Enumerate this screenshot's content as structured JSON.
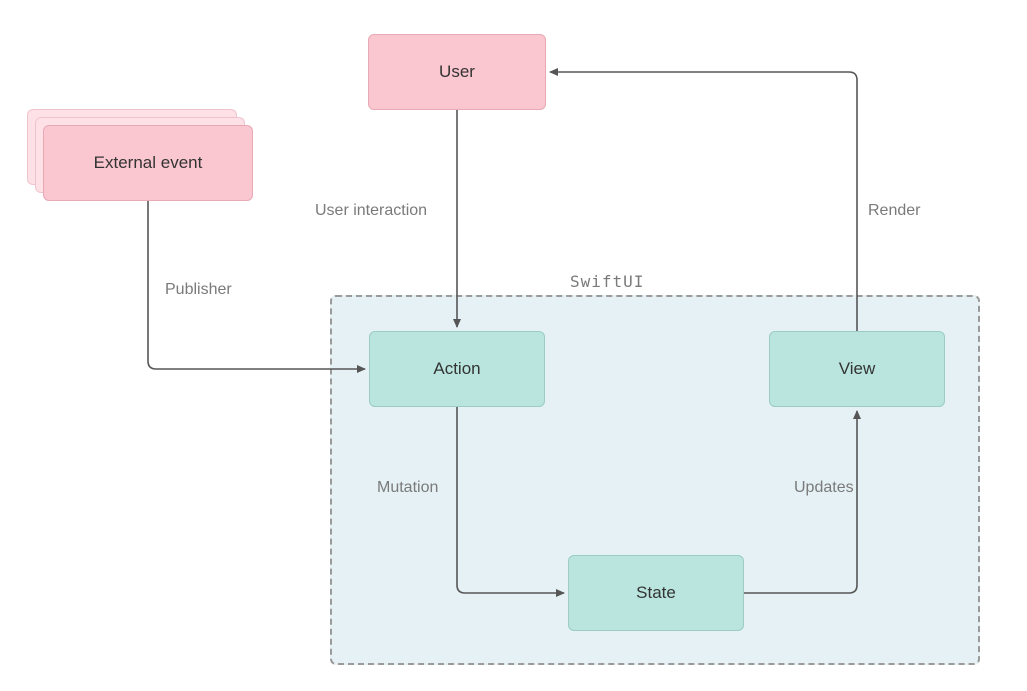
{
  "nodes": {
    "user": "User",
    "external_event": "External event",
    "action": "Action",
    "state": "State",
    "view": "View"
  },
  "edges": {
    "user_interaction": "User interaction",
    "publisher": "Publisher",
    "mutation": "Mutation",
    "updates": "Updates",
    "render": "Render"
  },
  "container": {
    "label": "SwiftUI"
  },
  "colors": {
    "pink": "#fac6cf",
    "pink_border": "#e8a9b5",
    "pink_shadow": "#fde1e6",
    "teal": "#b9e5de",
    "teal_border": "#9cccc4",
    "container_bg": "#e5f1f4",
    "container_border": "#9a9a9a",
    "arrow": "#565656",
    "text": "#333333",
    "label_text": "#7a7a7a"
  }
}
